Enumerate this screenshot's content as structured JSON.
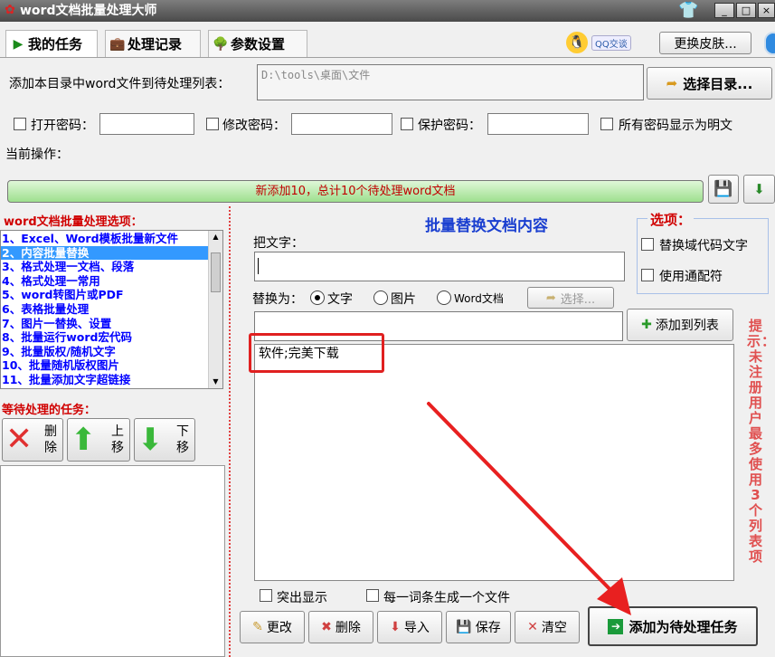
{
  "window": {
    "title": "word文档批量处理大师"
  },
  "tabs": [
    {
      "label": "我的任务"
    },
    {
      "label": "处理记录"
    },
    {
      "label": "参数设置"
    }
  ],
  "top": {
    "qq_label": "QQ交谈",
    "skin_button": "更换皮肤..."
  },
  "dir": {
    "label": "添加本目录中word文件到待处理列表：",
    "path": "D:\\tools\\桌面\\文件",
    "select_button": "选择目录..."
  },
  "passwords": {
    "open": "打开密码：",
    "modify": "修改密码：",
    "protect": "保护密码：",
    "show_plain": "所有密码显示为明文"
  },
  "current_op": {
    "label": "当前操作："
  },
  "progress": {
    "text": "新添加10，总计10个待处理word文档"
  },
  "options": {
    "title": "word文档批量处理选项：",
    "items": [
      "1、Excel、Word模板批量新文件",
      "2、内容批量替换",
      "3、格式处理一文档、段落",
      "4、格式处理一常用",
      "5、word转图片或PDF",
      "6、表格批量处理",
      "7、图片一替换、设置",
      "8、批量运行word宏代码",
      "9、批量版权/随机文字",
      "10、批量随机版权图片",
      "11、批量添加文字超链接"
    ],
    "selected": 1
  },
  "pending": {
    "title": "等待处理的任务：",
    "delete": "删除",
    "up": "上移",
    "down": "下移"
  },
  "replace": {
    "heading": "批量替换文档内容",
    "find_label": "把文字：",
    "replace_label": "替换为：",
    "opt_text": "文字",
    "opt_image": "图片",
    "opt_word": "Word文档",
    "select_button": "选择...",
    "add_to_list": "添加到列表",
    "entry": "软件;完美下载",
    "highlight": "突出显示",
    "per_file": "每一词条生成一个文件"
  },
  "option_box": {
    "title": "选项：",
    "replace_field": "替换域代码文字",
    "wildcard": "使用通配符"
  },
  "hint": {
    "text": "提示：未注册用户最多使用3个列表项"
  },
  "actions": {
    "edit": "更改",
    "delete": "删除",
    "import": "导入",
    "save": "保存",
    "clear": "清空",
    "add_task": "添加为待处理任务"
  }
}
